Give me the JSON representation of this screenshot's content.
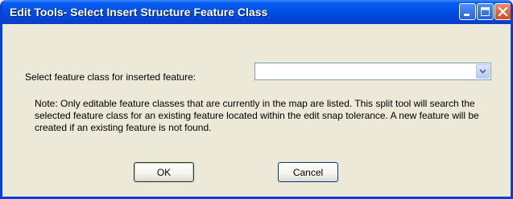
{
  "window": {
    "title": "Edit Tools- Select Insert Structure Feature Class",
    "controls": {
      "minimize_icon": "minimize-icon",
      "maximize_icon": "maximize-icon",
      "close_icon": "close-icon"
    }
  },
  "form": {
    "select_label": "Select feature class for inserted feature:",
    "select_value": "",
    "note": "Note:  Only editable feature classes that are currently in the map are listed.  This split tool will search the selected feature class for an existing feature located within the edit snap tolerance.  A new feature will be created if an existing feature is not found."
  },
  "buttons": {
    "ok_label": "OK",
    "cancel_label": "Cancel"
  },
  "colors": {
    "titlebar": "#0050e6",
    "dialog_background": "#ece9d8",
    "close_button": "#d44a1e",
    "combo_border": "#7f9db9"
  }
}
